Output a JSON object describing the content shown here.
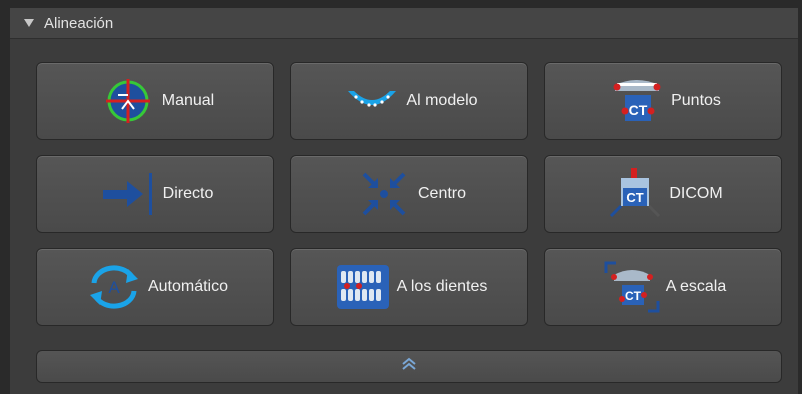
{
  "panel": {
    "title": "Alineación",
    "collapse_icon": "triangle-down-icon"
  },
  "buttons": [
    {
      "label": "Manual",
      "icon": "manual-crosshair-icon"
    },
    {
      "label": "Al modelo",
      "icon": "dental-arch-icon"
    },
    {
      "label": "Puntos",
      "icon": "ct-points-icon"
    },
    {
      "label": "Directo",
      "icon": "arrow-to-line-icon"
    },
    {
      "label": "Centro",
      "icon": "arrows-to-center-icon"
    },
    {
      "label": "DICOM",
      "icon": "ct-dicom-icon"
    },
    {
      "label": "Automático",
      "icon": "auto-align-icon"
    },
    {
      "label": "A los dientes",
      "icon": "teeth-icon"
    },
    {
      "label": "A escala",
      "icon": "ct-scale-icon"
    }
  ],
  "expand_button": {
    "icon": "double-chevron-up-icon"
  },
  "icon_labels": {
    "ct": "CT",
    "auto": "A"
  },
  "colors": {
    "accent_blue": "#1e4f9e",
    "marker_red": "#d42020",
    "ring_green": "#37c837"
  }
}
